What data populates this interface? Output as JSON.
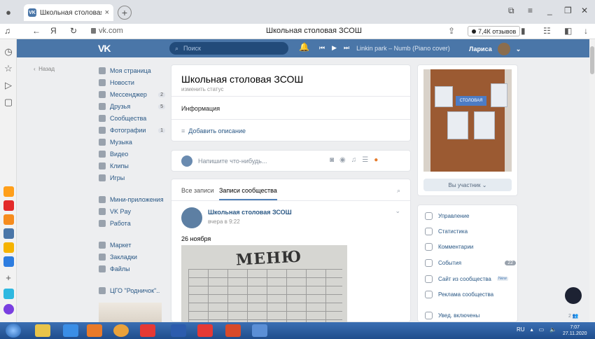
{
  "browser": {
    "tab_title": "Школьная столовая ЗС",
    "tab_close": "×",
    "new_tab": "+",
    "url": "vk.com",
    "page_title": "Школьная столовая ЗСОШ",
    "reviews": "7,4К отзывов",
    "nav_back": "←",
    "nav_yandex": "Я",
    "nav_reload": "↻"
  },
  "vk_header": {
    "logo": "VK",
    "search_placeholder": "Поиск",
    "track": "Linkin park – Numb (Piano cover)",
    "user_name": "Лариса"
  },
  "left_menu": {
    "back_label": "Назад",
    "items": [
      {
        "label": "Моя страница",
        "count": ""
      },
      {
        "label": "Новости",
        "count": ""
      },
      {
        "label": "Мессенджер",
        "count": "2"
      },
      {
        "label": "Друзья",
        "count": "5"
      },
      {
        "label": "Сообщества",
        "count": ""
      },
      {
        "label": "Фотографии",
        "count": "1"
      },
      {
        "label": "Музыка",
        "count": ""
      },
      {
        "label": "Видео",
        "count": ""
      },
      {
        "label": "Клипы",
        "count": ""
      },
      {
        "label": "Игры",
        "count": ""
      },
      {
        "label": "Мини-приложения",
        "count": ""
      },
      {
        "label": "VK Pay",
        "count": ""
      },
      {
        "label": "Работа",
        "count": ""
      },
      {
        "label": "Маркет",
        "count": ""
      },
      {
        "label": "Закладки",
        "count": ""
      },
      {
        "label": "Файлы",
        "count": ""
      },
      {
        "label": "ЦГО \"Родничок\"..",
        "count": ""
      }
    ]
  },
  "group": {
    "title": "Школьная столовая ЗСОШ",
    "status_link": "изменить статус",
    "info_label": "Информация",
    "add_description": "Добавить описание"
  },
  "composer": {
    "placeholder": "Напишите что-нибудь..."
  },
  "feed_tabs": {
    "all": "Все записи",
    "community": "Записи сообщества"
  },
  "post": {
    "author": "Школьная столовая ЗСОШ",
    "time": "вчера в 9:22",
    "text": "26 ноября",
    "image_word": "МЕНЮ"
  },
  "right": {
    "photo_sign": "СТОЛОВАЯ",
    "member_button": "Вы участник ⌄",
    "items": [
      {
        "label": "Управление",
        "badge": "",
        "tag": ""
      },
      {
        "label": "Статистика",
        "badge": "",
        "tag": ""
      },
      {
        "label": "Комментарии",
        "badge": "",
        "tag": ""
      },
      {
        "label": "События",
        "badge": "22",
        "tag": ""
      },
      {
        "label": "Сайт из сообщества",
        "badge": "",
        "tag": "New"
      },
      {
        "label": "Реклама сообщества",
        "badge": "",
        "tag": ""
      },
      {
        "label": "Увед. включены",
        "badge": "",
        "tag": ""
      }
    ],
    "floating_count": "2 👥"
  },
  "taskbar": {
    "lang": "RU",
    "time": "7:07",
    "date": "27.11.2020"
  },
  "colors": {
    "vk_blue": "#4a76a8",
    "link": "#2a5885",
    "background": "#edeef0"
  }
}
